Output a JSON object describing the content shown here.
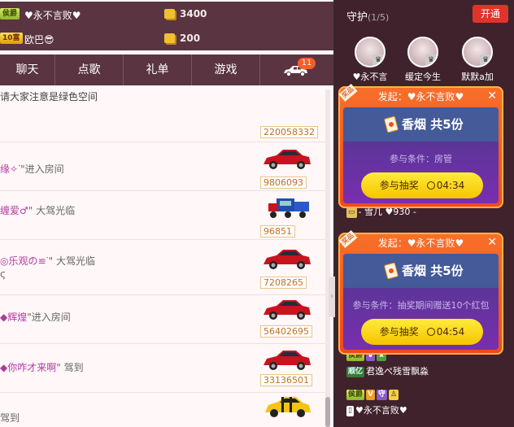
{
  "rank_rows": [
    {
      "badge": "侯爵",
      "name": "♥永不言败♥",
      "amount": "3400"
    },
    {
      "badge": "10富",
      "name": "欧巴😎",
      "amount": "200"
    }
  ],
  "tabs": [
    {
      "label": "聊天"
    },
    {
      "label": "点歌"
    },
    {
      "label": "礼单"
    },
    {
      "label": "游戏"
    },
    {
      "label": "",
      "icon": "car-icon",
      "badge": "11"
    }
  ],
  "notice": "请大家注意是绿色空间",
  "messages": [
    {
      "user": "",
      "action": "",
      "extra": "",
      "car_number": "220058332"
    },
    {
      "user": "缘✧ᐝ",
      "action": "\"进入房间",
      "extra": "",
      "car_number": "9806093"
    },
    {
      "user": "缠爱♂",
      "action": "\" 大驾光临",
      "extra": "",
      "car_number": "96851"
    },
    {
      "user": "◎乐观の≌ᐝ",
      "action": "\" 大驾光临",
      "extra": "ς",
      "car_number": "7208265"
    },
    {
      "user": "◆辉煌",
      "action": "\"进入房间",
      "extra": "",
      "car_number": "56402695"
    },
    {
      "user": "◆你咋才来啊",
      "action": "\" 驾到",
      "extra": "",
      "car_number": "33136501"
    },
    {
      "user": "",
      "action": "驾到",
      "extra": "",
      "car_number": ""
    }
  ],
  "guard": {
    "title": "守护",
    "count": "(1/5)",
    "open_label": "开通",
    "members": [
      {
        "name": "♥永不言"
      },
      {
        "name": "缓定今生"
      },
      {
        "name": "默默a加"
      }
    ]
  },
  "lotteries": [
    {
      "header": "发起：♥永不言败♥",
      "tag": "奖品",
      "prize": "香烟 共5份",
      "condition": "参与条件：房管",
      "join_label": "参与抽奖",
      "timer": "04:34"
    },
    {
      "header": "发起：♥永不言败♥",
      "tag": "奖品",
      "prize": "香烟 共5份",
      "condition": "参与条件：抽奖期间赠送10个红包",
      "join_label": "参与抽奖",
      "timer": "04:54"
    }
  ],
  "right_rows": [
    {
      "text": "- 雪几 ♥930 -"
    },
    {
      "badge": "侯爵",
      "text": ""
    },
    {
      "badge": "顺亿",
      "text": "君逸ぺ残雪飘淼"
    },
    {
      "badge": "侯爵",
      "text": ""
    },
    {
      "badge": "",
      "text": "♥永不言败♥"
    }
  ],
  "colors": {
    "header_bg": "#5a3440",
    "right_bg": "#40222c",
    "lottery_orange": "#f96f2a",
    "join_yellow": "#ffeb3b",
    "open_red": "#e0342a"
  }
}
